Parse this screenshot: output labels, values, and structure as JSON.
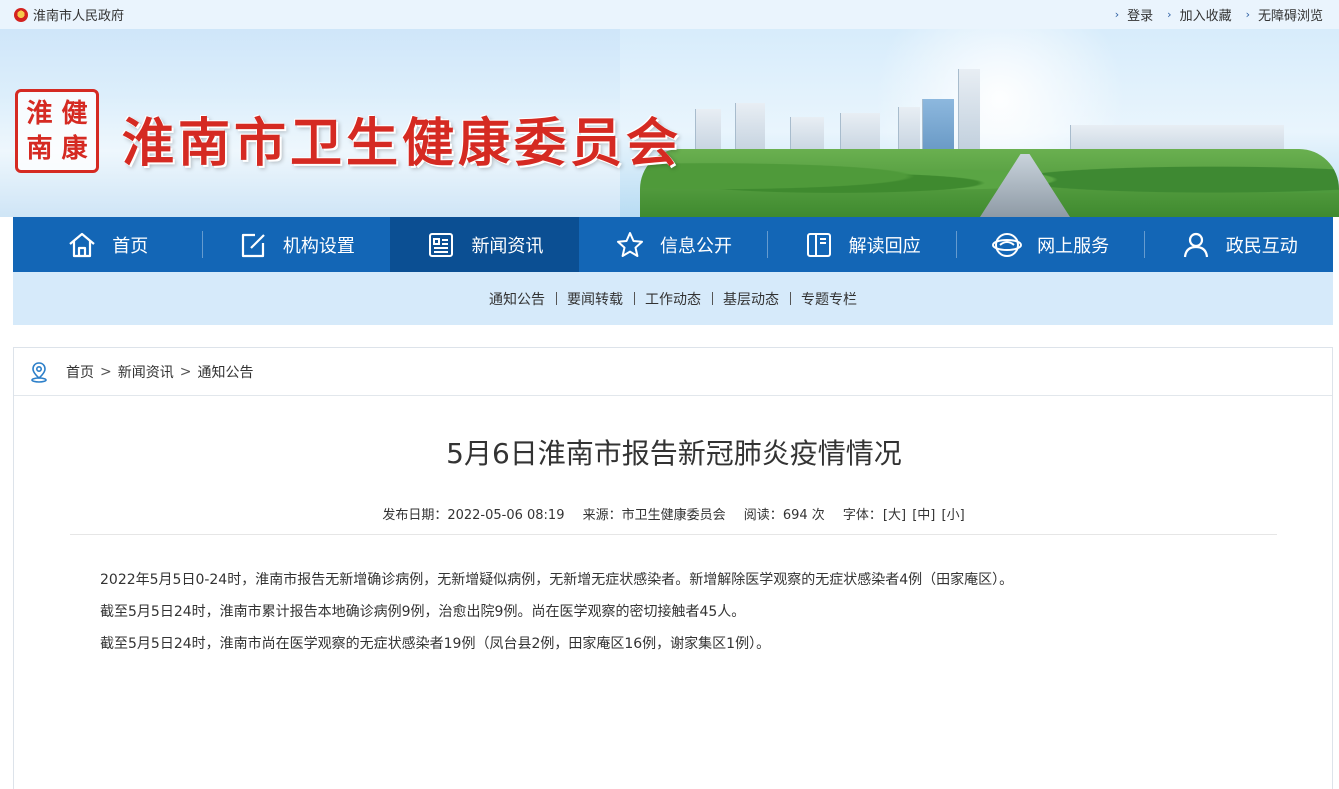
{
  "topbar": {
    "gov_name": "淮南市人民政府",
    "links": [
      "登录",
      "加入收藏",
      "无障碍浏览"
    ]
  },
  "banner": {
    "seal_chars": [
      "淮",
      "健",
      "南",
      "康"
    ],
    "title": "淮南市卫生健康委员会"
  },
  "nav": {
    "items": [
      {
        "label": "首页",
        "icon": "home-icon"
      },
      {
        "label": "机构设置",
        "icon": "edit-icon"
      },
      {
        "label": "新闻资讯",
        "icon": "news-icon"
      },
      {
        "label": "信息公开",
        "icon": "star-icon"
      },
      {
        "label": "解读回应",
        "icon": "book-icon"
      },
      {
        "label": "网上服务",
        "icon": "globe-icon"
      },
      {
        "label": "政民互动",
        "icon": "user-icon"
      }
    ],
    "active_index": 2
  },
  "subnav": {
    "items": [
      "通知公告",
      "要闻转载",
      "工作动态",
      "基层动态",
      "专题专栏"
    ]
  },
  "breadcrumb": {
    "items": [
      "首页",
      "新闻资讯",
      "通知公告"
    ],
    "sep": ">"
  },
  "article": {
    "title": "5月6日淮南市报告新冠肺炎疫情情况",
    "meta": {
      "date_label": "发布日期：",
      "date": "2022-05-06 08:19",
      "source_label": "来源：",
      "source": "市卫生健康委员会",
      "reads_label": "阅读：",
      "reads": "694 次",
      "font_label": "字体：",
      "font_sizes": [
        "[大]",
        "[中]",
        "[小]"
      ]
    },
    "paragraphs": [
      "2022年5月5日0-24时，淮南市报告无新增确诊病例，无新增疑似病例，无新增无症状感染者。新增解除医学观察的无症状感染者4例（田家庵区）。",
      "截至5月5日24时，淮南市累计报告本地确诊病例9例，治愈出院9例。尚在医学观察的密切接触者45人。",
      "截至5月5日24时，淮南市尚在医学观察的无症状感染者19例（凤台县2例，田家庵区16例，谢家集区1例）。"
    ]
  },
  "colors": {
    "nav_blue": "#1366b6",
    "nav_active": "#0b4f93",
    "subnav_bg": "#d6eafa",
    "brand_red": "#d52a22"
  }
}
